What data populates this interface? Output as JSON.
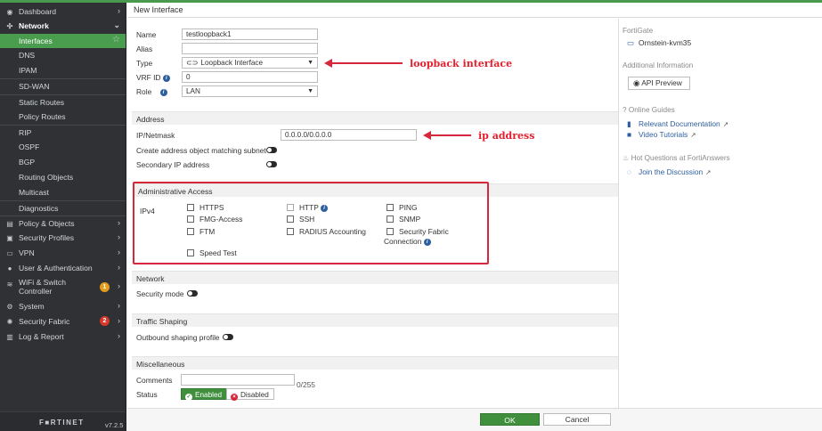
{
  "sidebar": {
    "items": [
      {
        "label": "Dashboard",
        "icon": "dashboard-icon"
      },
      {
        "label": "Network",
        "icon": "network-icon"
      },
      {
        "label": "Interfaces"
      },
      {
        "label": "DNS"
      },
      {
        "label": "IPAM"
      },
      {
        "label": "SD-WAN"
      },
      {
        "label": "Static Routes"
      },
      {
        "label": "Policy Routes"
      },
      {
        "label": "RIP"
      },
      {
        "label": "OSPF"
      },
      {
        "label": "BGP"
      },
      {
        "label": "Routing Objects"
      },
      {
        "label": "Multicast"
      },
      {
        "label": "Diagnostics"
      },
      {
        "label": "Policy & Objects",
        "icon": "policy-icon"
      },
      {
        "label": "Security Profiles",
        "icon": "lock-icon"
      },
      {
        "label": "VPN",
        "icon": "vpn-icon"
      },
      {
        "label": "User & Authentication",
        "icon": "user-icon"
      },
      {
        "label": "WiFi & Switch",
        "label2": "Controller",
        "icon": "wifi-icon",
        "badge": "1"
      },
      {
        "label": "System",
        "icon": "gear-icon"
      },
      {
        "label": "Security Fabric",
        "icon": "fabric-icon",
        "badge": "2"
      },
      {
        "label": "Log & Report",
        "icon": "chart-icon"
      }
    ],
    "logo": "F■RTINET",
    "version": "v7.2.5"
  },
  "header": {
    "title": "New Interface"
  },
  "form": {
    "name_label": "Name",
    "name_value": "testloopback1",
    "alias_label": "Alias",
    "alias_value": "",
    "type_label": "Type",
    "type_value": "Loopback Interface",
    "vrf_label": "VRF ID",
    "vrf_value": "0",
    "role_label": "Role",
    "role_value": "LAN",
    "address_section": "Address",
    "ipmask_label": "IP/Netmask",
    "ipmask_value": "0.0.0.0/0.0.0.0",
    "create_addr_label": "Create address object matching subnet",
    "secondary_ip_label": "Secondary IP address",
    "admin_section": "Administrative Access",
    "ipv4_label": "IPv4",
    "access": {
      "https": "HTTPS",
      "http": "HTTP",
      "ping": "PING",
      "fmg": "FMG-Access",
      "ssh": "SSH",
      "snmp": "SNMP",
      "ftm": "FTM",
      "radius": "RADIUS Accounting",
      "sec_fabric_1": "Security Fabric",
      "sec_fabric_2": "Connection",
      "speed_test": "Speed Test"
    },
    "network_section": "Network",
    "security_mode_label": "Security mode",
    "traffic_section": "Traffic Shaping",
    "outbound_label": "Outbound shaping profile",
    "misc_section": "Miscellaneous",
    "comments_label": "Comments",
    "comments_counter": "0/255",
    "status_label": "Status",
    "status_enabled": "Enabled",
    "status_disabled": "Disabled"
  },
  "annotations": {
    "loopback": "loopback interface",
    "ip": "ip address"
  },
  "right_panel": {
    "fortigate_heading": "FortiGate",
    "device_name": "Ornstein-kvm35",
    "additional_heading": "Additional Information",
    "api_preview": "API Preview",
    "online_guides_heading": "Online Guides",
    "relevant_docs": "Relevant Documentation",
    "video_tutorials": "Video Tutorials",
    "hot_questions_heading": "Hot Questions at FortiAnswers",
    "join_discussion": "Join the Discussion"
  },
  "footer": {
    "ok": "OK",
    "cancel": "Cancel"
  },
  "colors": {
    "accent_green": "#4a9d4e",
    "annotation_red": "#d6283a",
    "link_blue": "#2d5f9e"
  }
}
